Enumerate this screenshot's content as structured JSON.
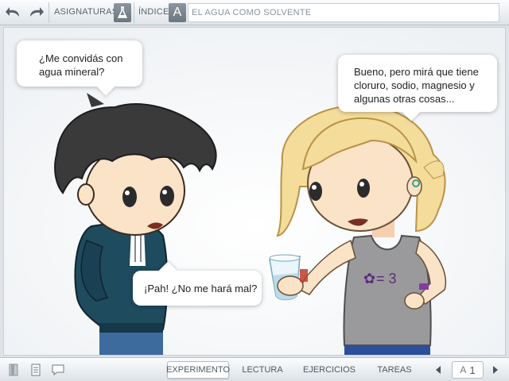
{
  "toolbar": {
    "subjects_label": "ASIGNATURAS",
    "index_label": "ÍNDICE",
    "index_icon_letter": "A",
    "title": "EL AGUA COMO SOLVENTE"
  },
  "comic": {
    "bubble_boy_top": "¿Me convidás con\nagua mineral?",
    "bubble_girl": "Bueno, pero mirá que tiene\ncloruro, sodio, magnesio y\nalgunas otras cosas...",
    "bubble_boy_bottom": "¡Pah! ¿No me hará mal?",
    "shirt_text": "= 3"
  },
  "bottom": {
    "tabs": [
      "EXPERIMENTO",
      "LECTURA",
      "EJERCICIOS",
      "TAREAS"
    ],
    "active_tab": "EXPERIMENTO",
    "page_letter": "A",
    "page_number": "1"
  },
  "colors": {
    "hoodie": "#1f4b5e",
    "hair_boy": "#3a3a3a",
    "hair_girl": "#f4dc9a",
    "skin": "#fbe3c8",
    "tank": "#9a9a9c",
    "jeans": "#3d6b9e"
  }
}
